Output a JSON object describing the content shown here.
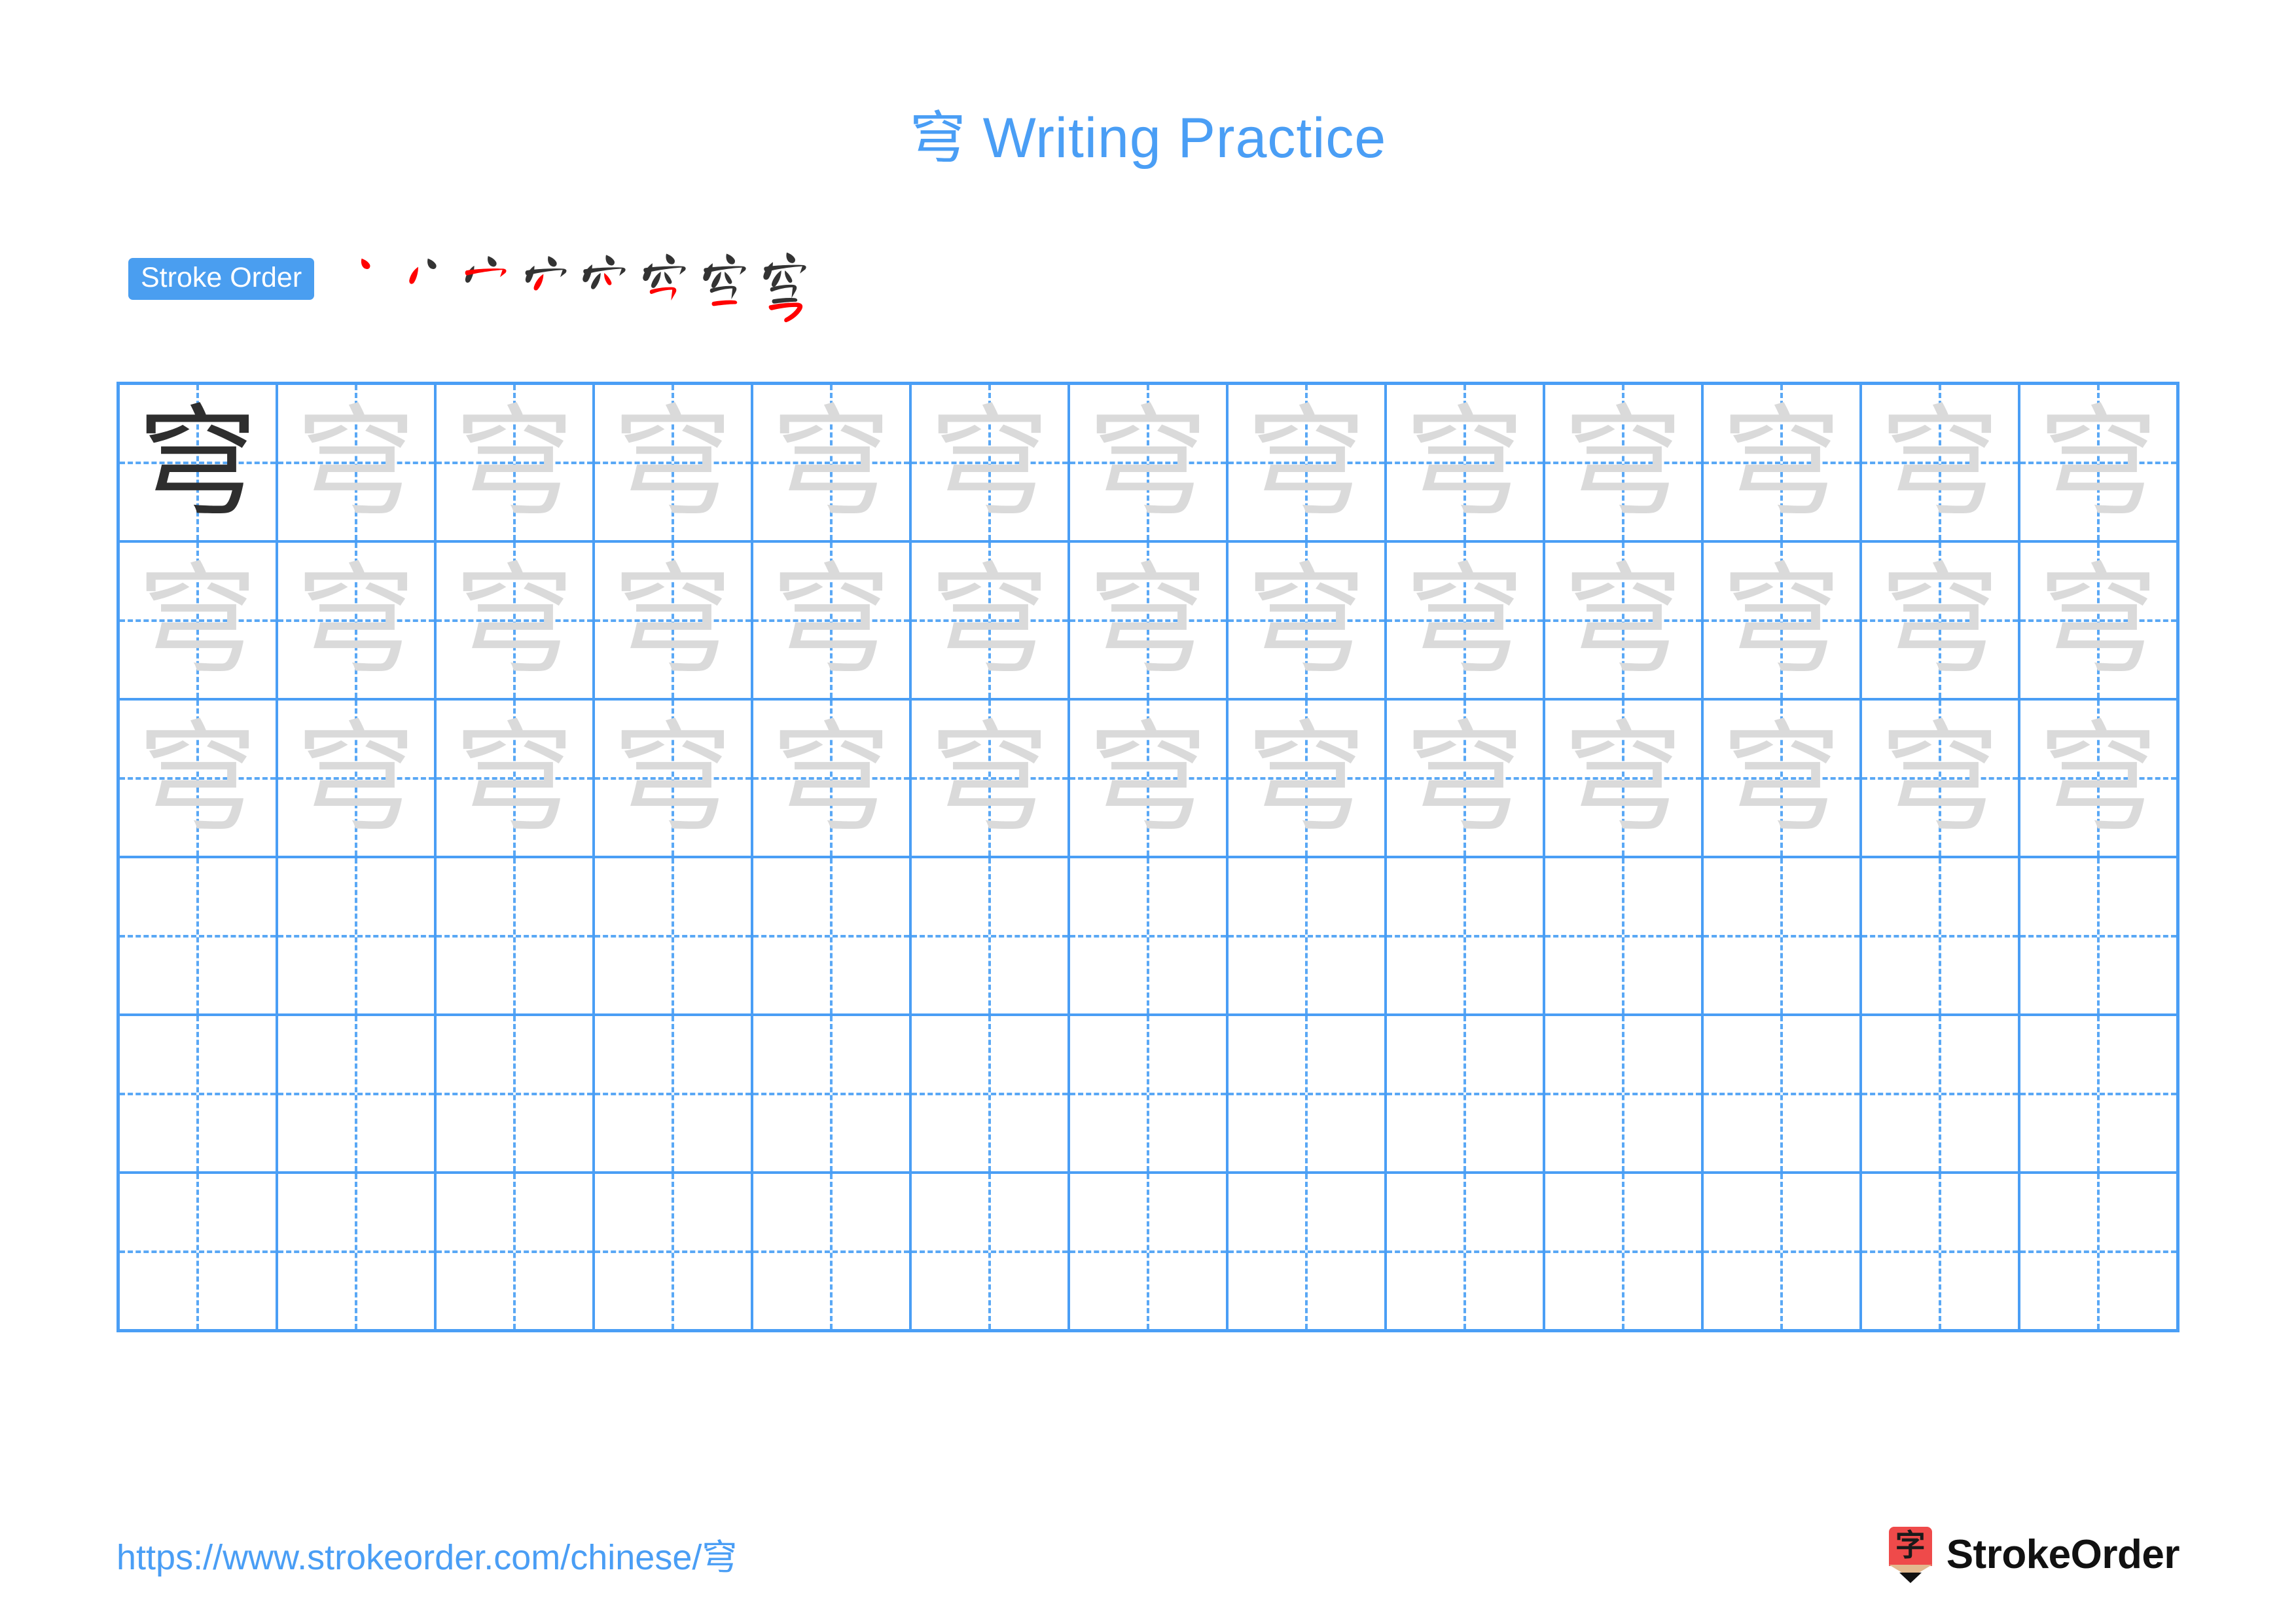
{
  "character": "穹",
  "header": {
    "title": "穹 Writing Practice"
  },
  "stroke_order": {
    "badge_label": "Stroke Order",
    "total_strokes": 8,
    "new_stroke_color": "#ff0000",
    "previous_stroke_color": "#333333",
    "steps": [
      {
        "index": 1,
        "label": "丶",
        "new_stroke": "dot"
      },
      {
        "index": 2,
        "label": "ハ",
        "new_stroke": "left-dot"
      },
      {
        "index": 3,
        "label": "宀",
        "new_stroke": "horizontal-hook"
      },
      {
        "index": 4,
        "label": "宀丿",
        "new_stroke": "left-slant"
      },
      {
        "index": 5,
        "label": "穴",
        "new_stroke": "right-dot"
      },
      {
        "index": 6,
        "label": "空",
        "new_stroke": "horizontal-fold"
      },
      {
        "index": 7,
        "label": "空一",
        "new_stroke": "horizontal"
      },
      {
        "index": 8,
        "label": "穹",
        "new_stroke": "hook-bend"
      }
    ]
  },
  "grid": {
    "columns": 13,
    "rows": 6,
    "line_color": "#4a9ef5",
    "guide_color": "#5aa8f5",
    "model_char_color": "#2e2e2e",
    "trace_char_color": "#dadada",
    "rows_data": [
      {
        "row": 1,
        "cells": [
          {
            "char": "穹",
            "style": "dark"
          },
          {
            "char": "穹",
            "style": "trace"
          },
          {
            "char": "穹",
            "style": "trace"
          },
          {
            "char": "穹",
            "style": "trace"
          },
          {
            "char": "穹",
            "style": "trace"
          },
          {
            "char": "穹",
            "style": "trace"
          },
          {
            "char": "穹",
            "style": "trace"
          },
          {
            "char": "穹",
            "style": "trace"
          },
          {
            "char": "穹",
            "style": "trace"
          },
          {
            "char": "穹",
            "style": "trace"
          },
          {
            "char": "穹",
            "style": "trace"
          },
          {
            "char": "穹",
            "style": "trace"
          },
          {
            "char": "穹",
            "style": "trace"
          }
        ]
      },
      {
        "row": 2,
        "cells": [
          {
            "char": "穹",
            "style": "trace"
          },
          {
            "char": "穹",
            "style": "trace"
          },
          {
            "char": "穹",
            "style": "trace"
          },
          {
            "char": "穹",
            "style": "trace"
          },
          {
            "char": "穹",
            "style": "trace"
          },
          {
            "char": "穹",
            "style": "trace"
          },
          {
            "char": "穹",
            "style": "trace"
          },
          {
            "char": "穹",
            "style": "trace"
          },
          {
            "char": "穹",
            "style": "trace"
          },
          {
            "char": "穹",
            "style": "trace"
          },
          {
            "char": "穹",
            "style": "trace"
          },
          {
            "char": "穹",
            "style": "trace"
          },
          {
            "char": "穹",
            "style": "trace"
          }
        ]
      },
      {
        "row": 3,
        "cells": [
          {
            "char": "穹",
            "style": "trace"
          },
          {
            "char": "穹",
            "style": "trace"
          },
          {
            "char": "穹",
            "style": "trace"
          },
          {
            "char": "穹",
            "style": "trace"
          },
          {
            "char": "穹",
            "style": "trace"
          },
          {
            "char": "穹",
            "style": "trace"
          },
          {
            "char": "穹",
            "style": "trace"
          },
          {
            "char": "穹",
            "style": "trace"
          },
          {
            "char": "穹",
            "style": "trace"
          },
          {
            "char": "穹",
            "style": "trace"
          },
          {
            "char": "穹",
            "style": "trace"
          },
          {
            "char": "穹",
            "style": "trace"
          },
          {
            "char": "穹",
            "style": "trace"
          }
        ]
      },
      {
        "row": 4,
        "cells": [
          {
            "char": "",
            "style": "empty"
          },
          {
            "char": "",
            "style": "empty"
          },
          {
            "char": "",
            "style": "empty"
          },
          {
            "char": "",
            "style": "empty"
          },
          {
            "char": "",
            "style": "empty"
          },
          {
            "char": "",
            "style": "empty"
          },
          {
            "char": "",
            "style": "empty"
          },
          {
            "char": "",
            "style": "empty"
          },
          {
            "char": "",
            "style": "empty"
          },
          {
            "char": "",
            "style": "empty"
          },
          {
            "char": "",
            "style": "empty"
          },
          {
            "char": "",
            "style": "empty"
          },
          {
            "char": "",
            "style": "empty"
          }
        ]
      },
      {
        "row": 5,
        "cells": [
          {
            "char": "",
            "style": "empty"
          },
          {
            "char": "",
            "style": "empty"
          },
          {
            "char": "",
            "style": "empty"
          },
          {
            "char": "",
            "style": "empty"
          },
          {
            "char": "",
            "style": "empty"
          },
          {
            "char": "",
            "style": "empty"
          },
          {
            "char": "",
            "style": "empty"
          },
          {
            "char": "",
            "style": "empty"
          },
          {
            "char": "",
            "style": "empty"
          },
          {
            "char": "",
            "style": "empty"
          },
          {
            "char": "",
            "style": "empty"
          },
          {
            "char": "",
            "style": "empty"
          },
          {
            "char": "",
            "style": "empty"
          }
        ]
      },
      {
        "row": 6,
        "cells": [
          {
            "char": "",
            "style": "empty"
          },
          {
            "char": "",
            "style": "empty"
          },
          {
            "char": "",
            "style": "empty"
          },
          {
            "char": "",
            "style": "empty"
          },
          {
            "char": "",
            "style": "empty"
          },
          {
            "char": "",
            "style": "empty"
          },
          {
            "char": "",
            "style": "empty"
          },
          {
            "char": "",
            "style": "empty"
          },
          {
            "char": "",
            "style": "empty"
          },
          {
            "char": "",
            "style": "empty"
          },
          {
            "char": "",
            "style": "empty"
          },
          {
            "char": "",
            "style": "empty"
          },
          {
            "char": "",
            "style": "empty"
          }
        ]
      }
    ]
  },
  "footer": {
    "url": "https://www.strokeorder.com/chinese/穹",
    "brand_name": "StrokeOrder",
    "brand_glyph": "字",
    "brand_logo_color": "#ef4a4a"
  }
}
